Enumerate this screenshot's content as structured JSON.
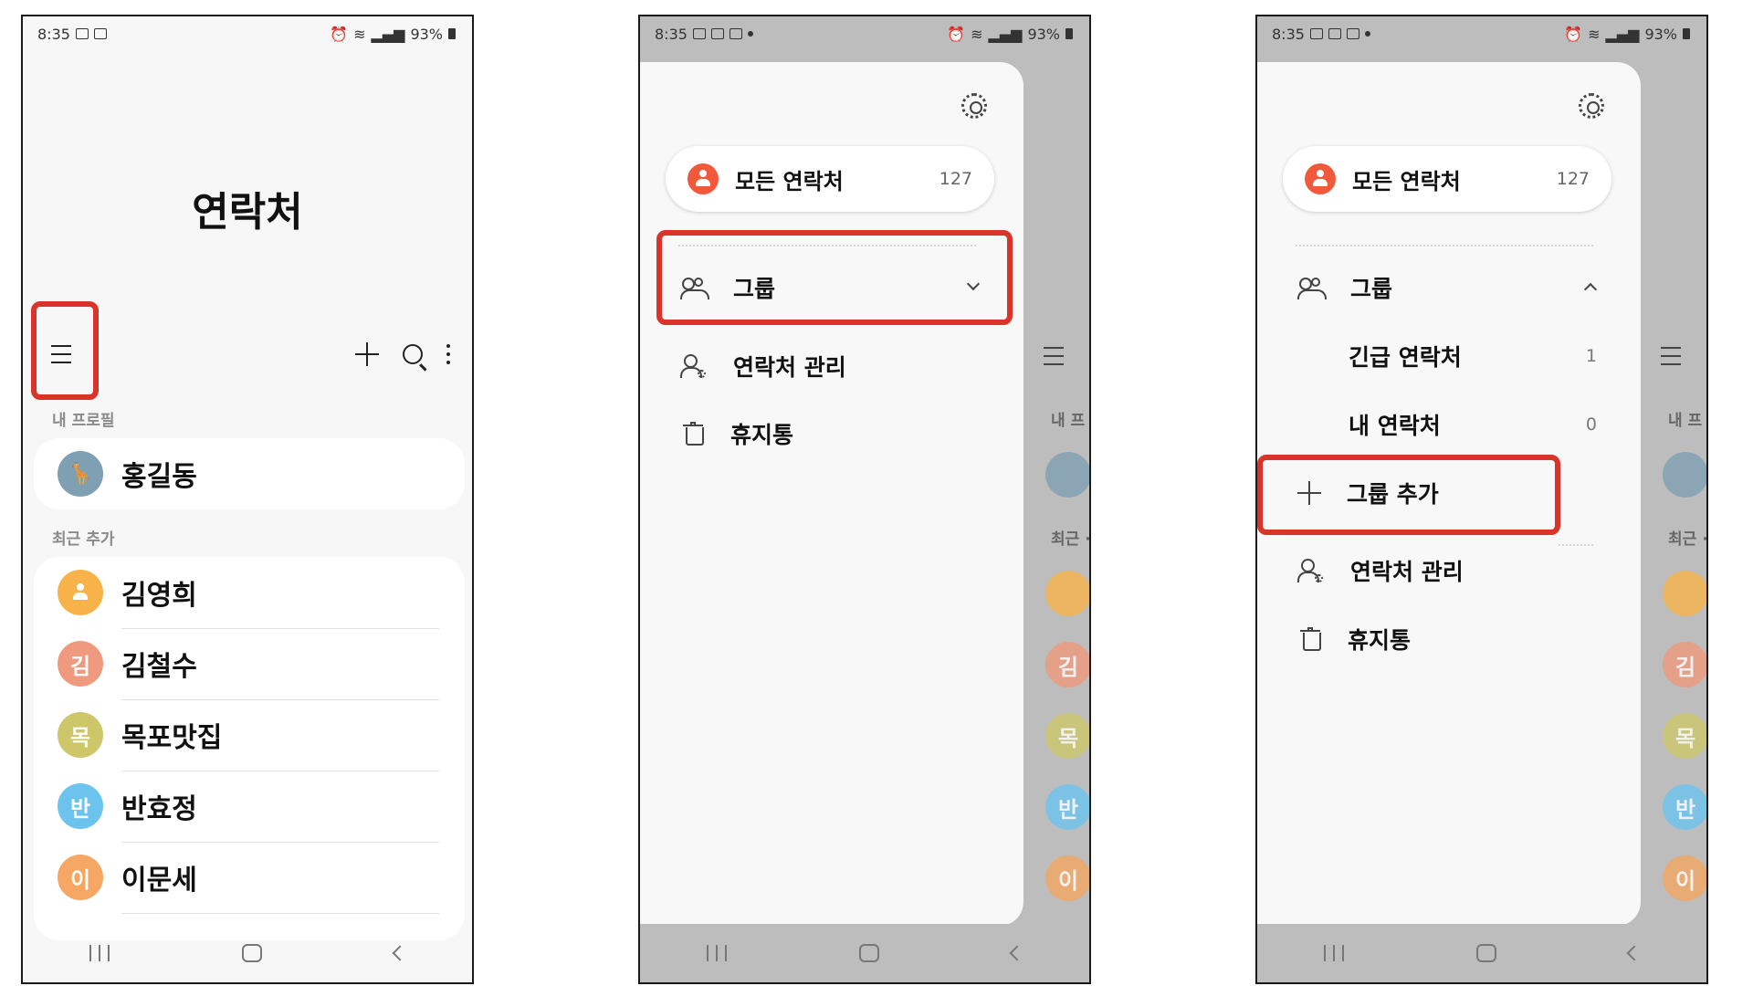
{
  "status": {
    "time": "8:35",
    "battery": "93%"
  },
  "screen1": {
    "title": "연락처",
    "my_profile_label": "내 프로필",
    "profile_name": "홍길동",
    "recent_label": "최근 추가",
    "contacts": [
      {
        "name": "김영희",
        "initial": "",
        "color": "#f7b34a"
      },
      {
        "name": "김철수",
        "initial": "김",
        "color": "#ef9a7e"
      },
      {
        "name": "목포맛집",
        "initial": "목",
        "color": "#cdc76a"
      },
      {
        "name": "반효정",
        "initial": "반",
        "color": "#6cc4ee"
      },
      {
        "name": "이문세",
        "initial": "이",
        "color": "#f5a763"
      }
    ]
  },
  "drawer": {
    "all_contacts": "모든 연락처",
    "all_count": "127",
    "groups": "그룹",
    "manage": "연락처 관리",
    "trash": "휴지통",
    "sub_groups": [
      {
        "name": "긴급 연락처",
        "count": "1"
      },
      {
        "name": "내 연락처",
        "count": "0"
      }
    ],
    "add_group": "그룹 추가"
  },
  "behind": {
    "my_label": "내 프",
    "recent_label": "최근 ·"
  },
  "colors": {
    "accent": "#f2583a",
    "highlight": "#d9332a"
  }
}
